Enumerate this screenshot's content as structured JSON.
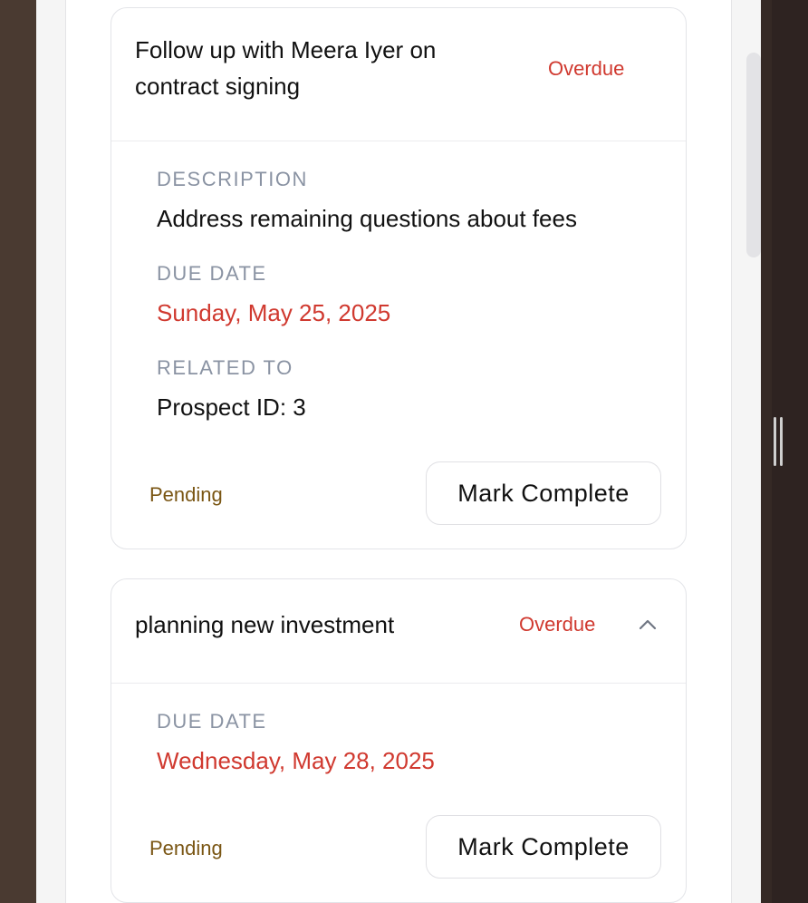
{
  "tasks": [
    {
      "title": "Follow up with Meera Iyer on contract signing",
      "badge": "Overdue",
      "description_label": "DESCRIPTION",
      "description": "Address remaining questions about fees",
      "due_label": "DUE DATE",
      "due_date": "Sunday, May 25, 2025",
      "related_label": "RELATED TO",
      "related": "Prospect ID: 3",
      "status": "Pending",
      "action_label": "Mark Complete"
    },
    {
      "title": "planning new investment",
      "badge": "Overdue",
      "toggle_icon": "chevron-up-icon",
      "due_label": "DUE DATE",
      "due_date": "Wednesday, May 28, 2025",
      "status": "Pending",
      "action_label": "Mark Complete"
    }
  ],
  "colors": {
    "overdue": "#d0392f",
    "label": "#8a93a3",
    "pending": "#7a5614",
    "border": "#e3e4e8"
  }
}
